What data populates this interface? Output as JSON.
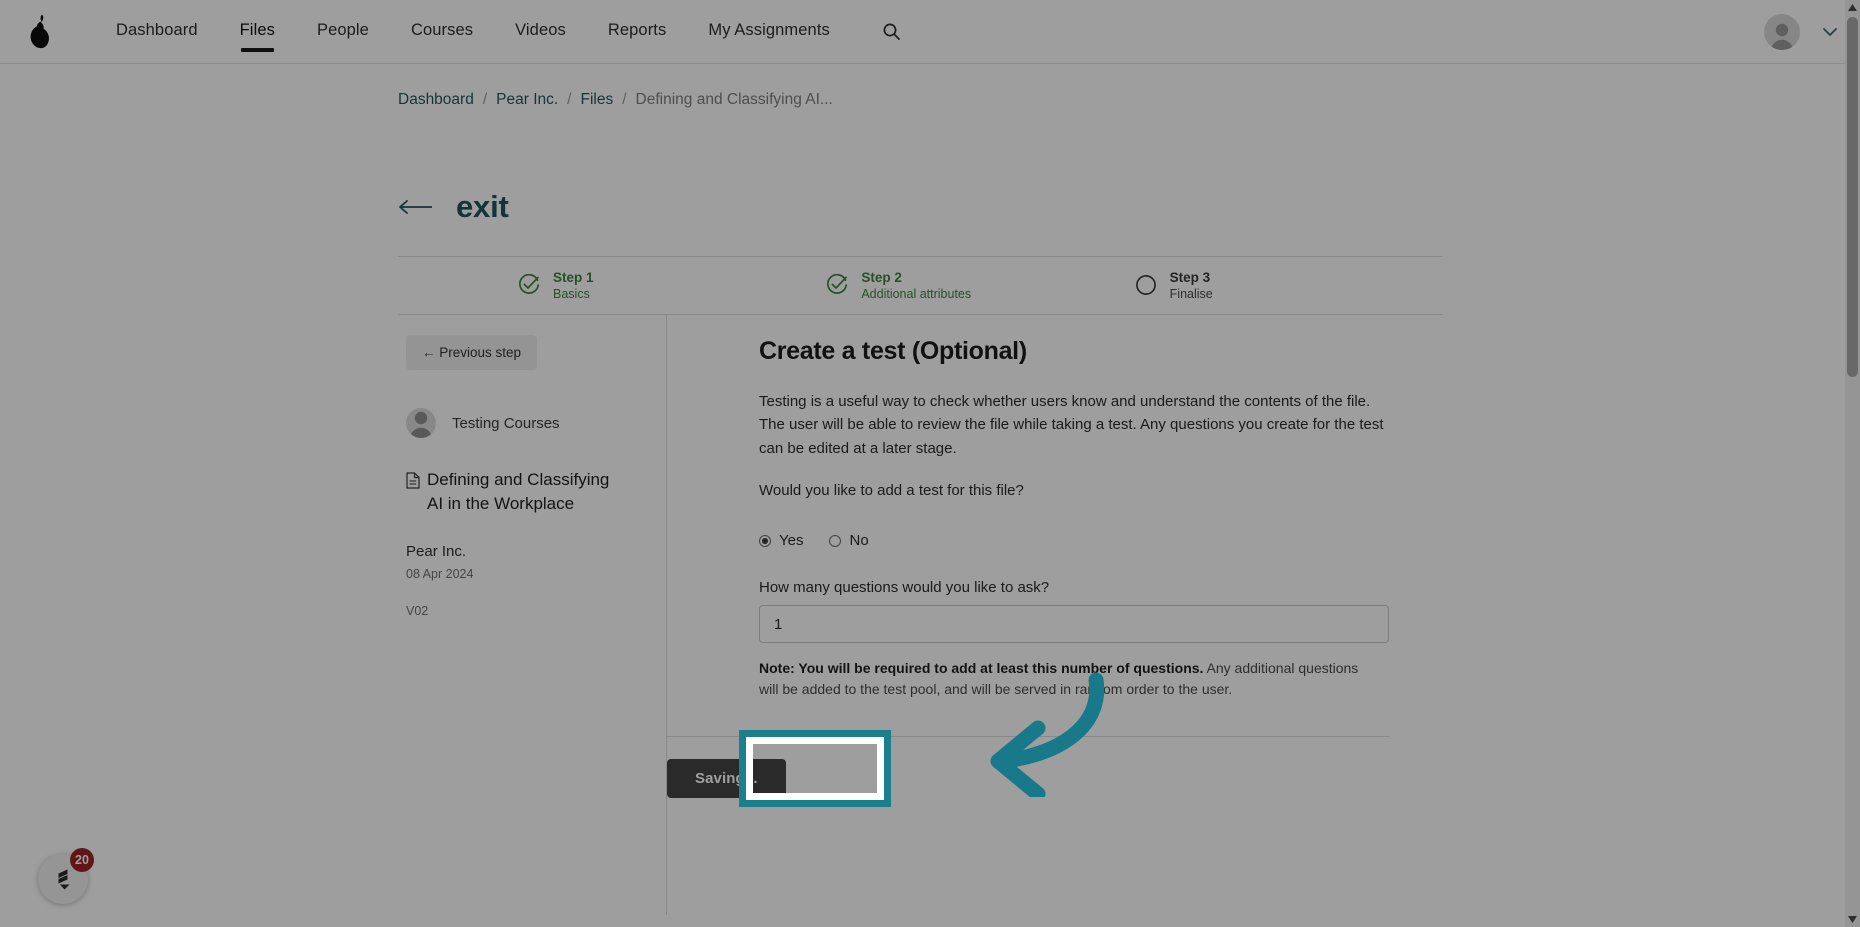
{
  "nav": {
    "logo_name": "pear-logo",
    "links": [
      {
        "label": "Dashboard",
        "active": false
      },
      {
        "label": "Files",
        "active": true
      },
      {
        "label": "People",
        "active": false
      },
      {
        "label": "Courses",
        "active": false
      },
      {
        "label": "Videos",
        "active": false
      },
      {
        "label": "Reports",
        "active": false
      },
      {
        "label": "My Assignments",
        "active": false
      }
    ],
    "search_icon": "search-icon",
    "avatar_icon": "user-avatar-icon",
    "caret_icon": "chevron-down-icon"
  },
  "breadcrumb": {
    "items": [
      "Dashboard",
      "Pear Inc.",
      "Files"
    ],
    "current": "Defining and Classifying AI...",
    "separator": "/"
  },
  "exit": {
    "label": "exit",
    "arrow_icon": "arrow-left-icon",
    "color": "#0d5a62"
  },
  "stepper": {
    "steps": [
      {
        "title": "Step 1",
        "subtitle": "Basics",
        "state": "done",
        "icon": "check-circle-icon"
      },
      {
        "title": "Step 2",
        "subtitle": "Additional attributes",
        "state": "done",
        "icon": "check-circle-icon"
      },
      {
        "title": "Step 3",
        "subtitle": "Finalise",
        "state": "todo",
        "icon": "empty-circle-icon"
      }
    ],
    "done_color": "#2a8a2e",
    "todo_color": "#3a3a3a"
  },
  "sidebar": {
    "previous_step_button": "← Previous step",
    "course_name": "Testing Courses",
    "course_avatar_icon": "user-avatar-icon",
    "file_icon": "file-document-icon",
    "file_title": "Defining and Classifying AI in the Workplace",
    "organisation": "Pear Inc.",
    "date": "08 Apr 2024",
    "version": "V02"
  },
  "main": {
    "title": "Create a test (Optional)",
    "paragraph": "Testing is a useful way to check whether users know and understand the contents of the file. The user will be able to review the file while taking a test. Any questions you create for the test can be edited at a later stage.",
    "question": "Would you like to add a test for this file?",
    "radio": {
      "options": [
        {
          "label": "Yes",
          "checked": true
        },
        {
          "label": "No",
          "checked": false
        }
      ]
    },
    "field_label": "How many questions would you like to ask?",
    "field_value": "1",
    "field_placeholder": "",
    "note_bold": "Note: You will be required to add at least this number of questions.",
    "note_rest": " Any additional questions will be added to the test pool, and will be served in random order to the user.",
    "submit_button": "Saving..."
  },
  "chat_widget": {
    "badge": "20",
    "icon": "chat-bubble-icon"
  },
  "scrollbar": {
    "up_icon": "scroll-up-arrow-icon",
    "down_icon": "scroll-down-arrow-icon"
  },
  "annotation": {
    "highlight_color": "#1c7f8e",
    "arrow_icon": "curved-arrow-left-icon",
    "target": "Saving..."
  }
}
